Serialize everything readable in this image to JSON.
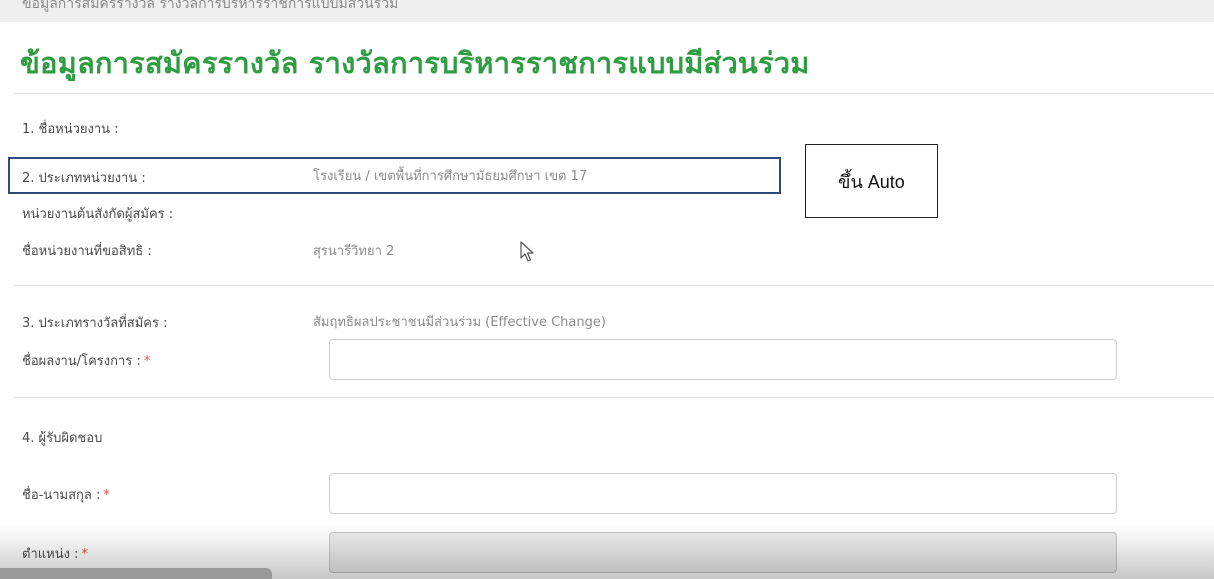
{
  "header": {
    "breadcrumb": "ข้อมูลการสมัครรางวัล รางวัลการบริหารราชการแบบมีส่วนร่วม",
    "title": "ข้อมูลการสมัครรางวัล รางวัลการบริหารราชการแบบมีส่วนร่วม"
  },
  "section1": {
    "label": "1. ชื่อหน่วยงาน :"
  },
  "section2": {
    "label": "2. ประเภทหน่วยงาน :",
    "value": "โรงเรียน / เขตพื้นที่การศึกษามัธยมศึกษา เขต 17",
    "parent_label": "หน่วยงานต้นสังกัดผู้สมัคร :",
    "agency_label": "ชื่อหน่วยงานที่ขอสิทธิ :",
    "agency_value": "สุรนารีวิทยา 2"
  },
  "callout": {
    "text": "ขึ้น Auto"
  },
  "section3": {
    "label": "3. ประเภทรางวัลที่สมัคร :",
    "value": "สัมฤทธิผลประชาชนมีส่วนร่วม (Effective Change)",
    "project_label": "ชื่อผลงาน/โครงการ :",
    "project_value": ""
  },
  "section4": {
    "label": "4. ผู้รับผิดชอบ",
    "name_label": "ชื่อ-นามสกุล :",
    "name_value": "",
    "position_label": "ตำแหน่ง :",
    "position_value": ""
  },
  "required_mark": "*",
  "colors": {
    "title": "#2e9c41",
    "highlight_border": "#2d4a79",
    "required": "#d9534f"
  },
  "icons": {
    "cursor": "mouse-pointer-icon"
  }
}
